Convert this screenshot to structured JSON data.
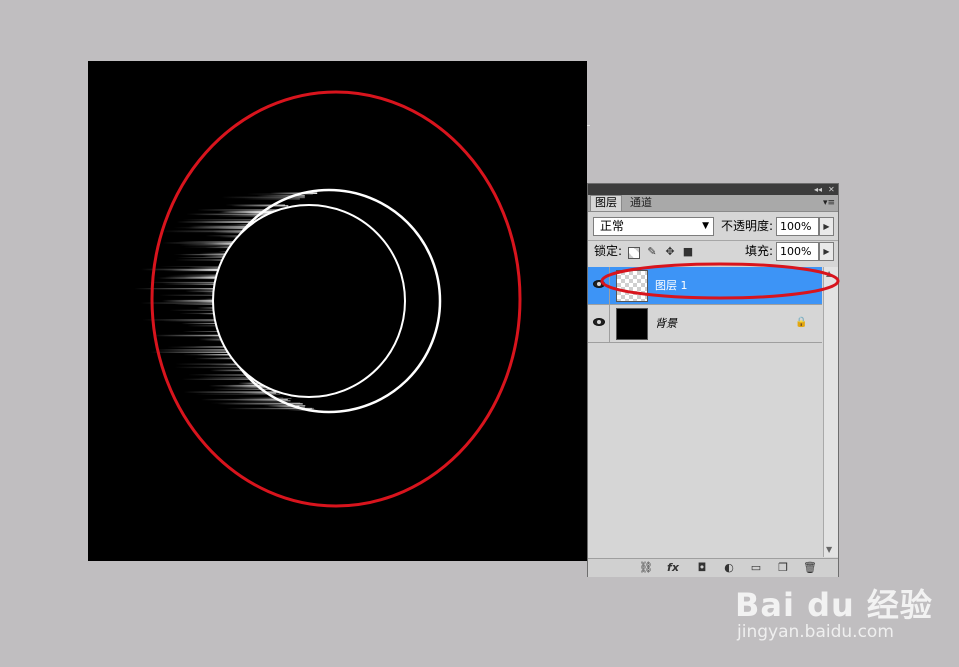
{
  "colors": {
    "workspace": "#c0bec0",
    "canvas": "#000000",
    "annotation": "#d8141d",
    "selected_layer": "#3d94f6"
  },
  "layers_panel": {
    "tabs": [
      {
        "label": "图层",
        "active": true
      },
      {
        "label": "通道",
        "active": false
      }
    ],
    "blend_mode": "正常",
    "opacity_label": "不透明度:",
    "opacity_value": "100%",
    "lock_label": "锁定:",
    "fill_label": "填充:",
    "fill_value": "100%",
    "lock_icons": [
      "lock-transparent-icon",
      "lock-paint-icon",
      "lock-move-icon",
      "lock-all-icon"
    ],
    "layers": [
      {
        "name": "图层 1",
        "selected": true,
        "visible": true,
        "thumbnail": "transparent"
      },
      {
        "name": "背景",
        "selected": false,
        "visible": true,
        "thumbnail": "black",
        "locked": true
      }
    ],
    "bottom_icons": [
      "link-icon",
      "fx-icon",
      "mask-icon",
      "adjustment-icon",
      "group-folder-icon",
      "new-layer-icon",
      "trash-icon"
    ]
  },
  "watermark": {
    "logo": "Bai du 经验",
    "url": "jingyan.baidu.com"
  }
}
